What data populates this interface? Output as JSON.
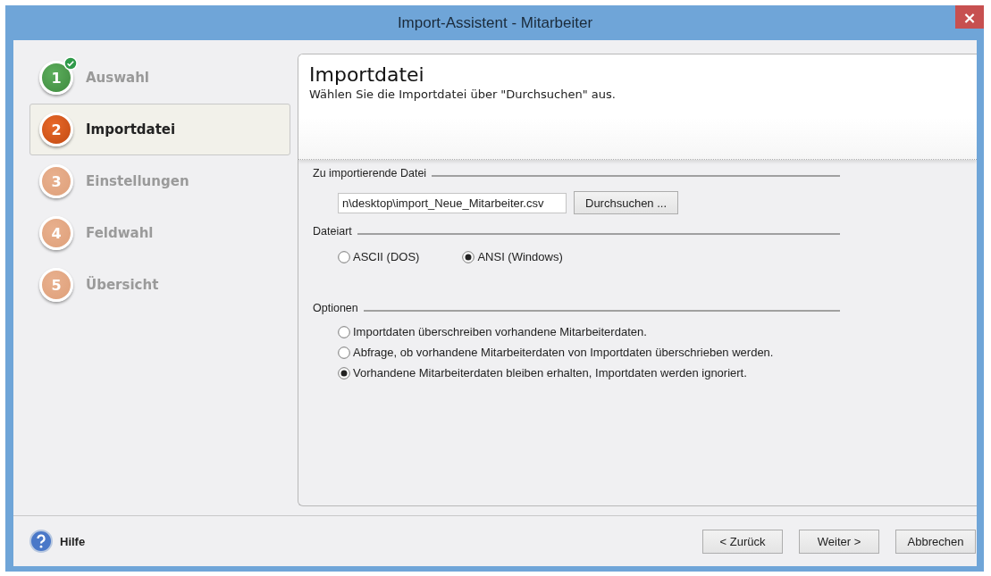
{
  "window": {
    "title": "Import-Assistent - Mitarbeiter",
    "close": "×"
  },
  "steps": [
    {
      "number": "1",
      "label": "Auswahl",
      "kind": "done",
      "selected": false
    },
    {
      "number": "2",
      "label": "Importdatei",
      "kind": "current",
      "selected": true
    },
    {
      "number": "3",
      "label": "Einstellungen",
      "kind": "pending",
      "selected": false
    },
    {
      "number": "4",
      "label": "Feldwahl",
      "kind": "pending",
      "selected": false
    },
    {
      "number": "5",
      "label": "Übersicht",
      "kind": "pending",
      "selected": false
    }
  ],
  "header": {
    "title": "Importdatei",
    "subtitle": "Wählen Sie die Importdatei über \"Durchsuchen\" aus."
  },
  "file_group": {
    "label": "Zu importierende Datei",
    "path": "n\\desktop\\import_Neue_Mitarbeiter.csv",
    "browse_button": "Durchsuchen ..."
  },
  "file_type": {
    "label": "Dateiart",
    "options": [
      {
        "label": "ASCII (DOS)",
        "selected": false
      },
      {
        "label": "ANSI (Windows)",
        "selected": true
      }
    ]
  },
  "options": {
    "label": "Optionen",
    "choices": [
      {
        "label": "Importdaten überschreiben vorhandene Mitarbeiterdaten.",
        "selected": false
      },
      {
        "label": "Abfrage, ob vorhandene Mitarbeiterdaten von Importdaten überschrieben werden.",
        "selected": false
      },
      {
        "label": "Vorhandene Mitarbeiterdaten bleiben erhalten, Importdaten werden ignoriert.",
        "selected": true
      }
    ]
  },
  "footer": {
    "help": "Hilfe",
    "buttons": [
      "< Zurück",
      "Weiter >",
      "Abbrechen"
    ]
  }
}
